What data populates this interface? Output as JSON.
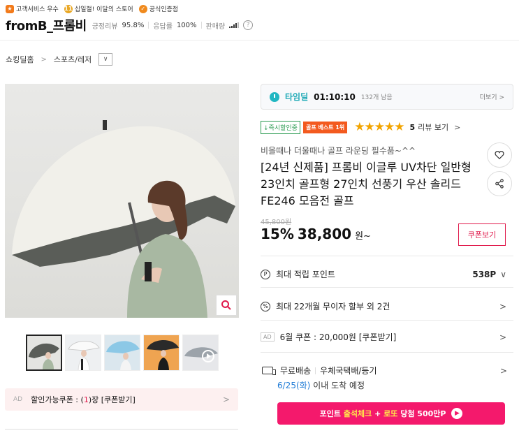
{
  "seller_badges": [
    {
      "icon": "star-badge-icon",
      "label": "고객서비스 우수"
    },
    {
      "icon": "medal-badge-icon",
      "label": "십일절! 이달의 스토어"
    },
    {
      "icon": "certified-badge-icon",
      "label": "공식인증점"
    }
  ],
  "store": {
    "name": "fromB_프롬비",
    "review_label": "긍정리뷰",
    "review_value": "95.8%",
    "response_label": "응답률",
    "response_value": "100%",
    "sales_label": "판매량",
    "help": "?"
  },
  "breadcrumb": {
    "home": "쇼킹딜홈",
    "separator": ">",
    "category": "스포츠/레저",
    "dropdown": "∨"
  },
  "timedeal": {
    "label": "타임딜",
    "time": "01:10:10",
    "remaining": "132개 남음",
    "more": "더보기 >"
  },
  "tags": {
    "instant_discount": "↓즉시할인중",
    "best": "골프 베스트 1위",
    "stars": "★★★★★",
    "rating": 5,
    "review_count": "5",
    "review_link": "리뷰 보기",
    "review_chevron": ">"
  },
  "product": {
    "subtitle": "비올때나 더울때나 골프 라운딩 필수품~^^",
    "title": "[24년 신제품] 프롬비 이글루 UV차단 일반형 23인치 골프형 27인치 선풍기 우산 솔리드 FE246 모음전 골프",
    "original_price": "45,800원",
    "discount": "15%",
    "price": "38,800",
    "price_suffix": "원~",
    "coupon_button": "쿠폰보기"
  },
  "info": {
    "points_icon": "P",
    "points_label": "최대 적립 포인트",
    "points_value": "538P",
    "installment_icon": "%",
    "installment_label": "최대 22개월 무이자 할부 외 2건",
    "ad_tag": "AD",
    "coupon_label": "6월 쿠폰 : 20,000원 [쿠폰받기]",
    "shipping_label": "무료배송",
    "shipping_carrier": "우체국택배/등기",
    "delivery_date": "6/25(화)",
    "delivery_suffix": " 이내 도착 예정",
    "chevron_right": ">",
    "chevron_down": "∨"
  },
  "promo": {
    "prefix": "포인트 ",
    "highlight1": "출석체크",
    "middle": " + ",
    "highlight2": "로또",
    "suffix": " 당첨 500만P"
  },
  "coupon_strip": {
    "ad": "AD",
    "prefix": "할인가능쿠폰 : (",
    "count": "1",
    "suffix": ")장 [쿠폰받기]",
    "chevron": ">"
  },
  "colors": {
    "accent": "#e0194b",
    "promo_bg": "#f4196c",
    "timedeal": "#1ea9b6",
    "star": "#f2a400",
    "best_tag": "#f35a1f",
    "delivery_date": "#1f7bd6"
  }
}
